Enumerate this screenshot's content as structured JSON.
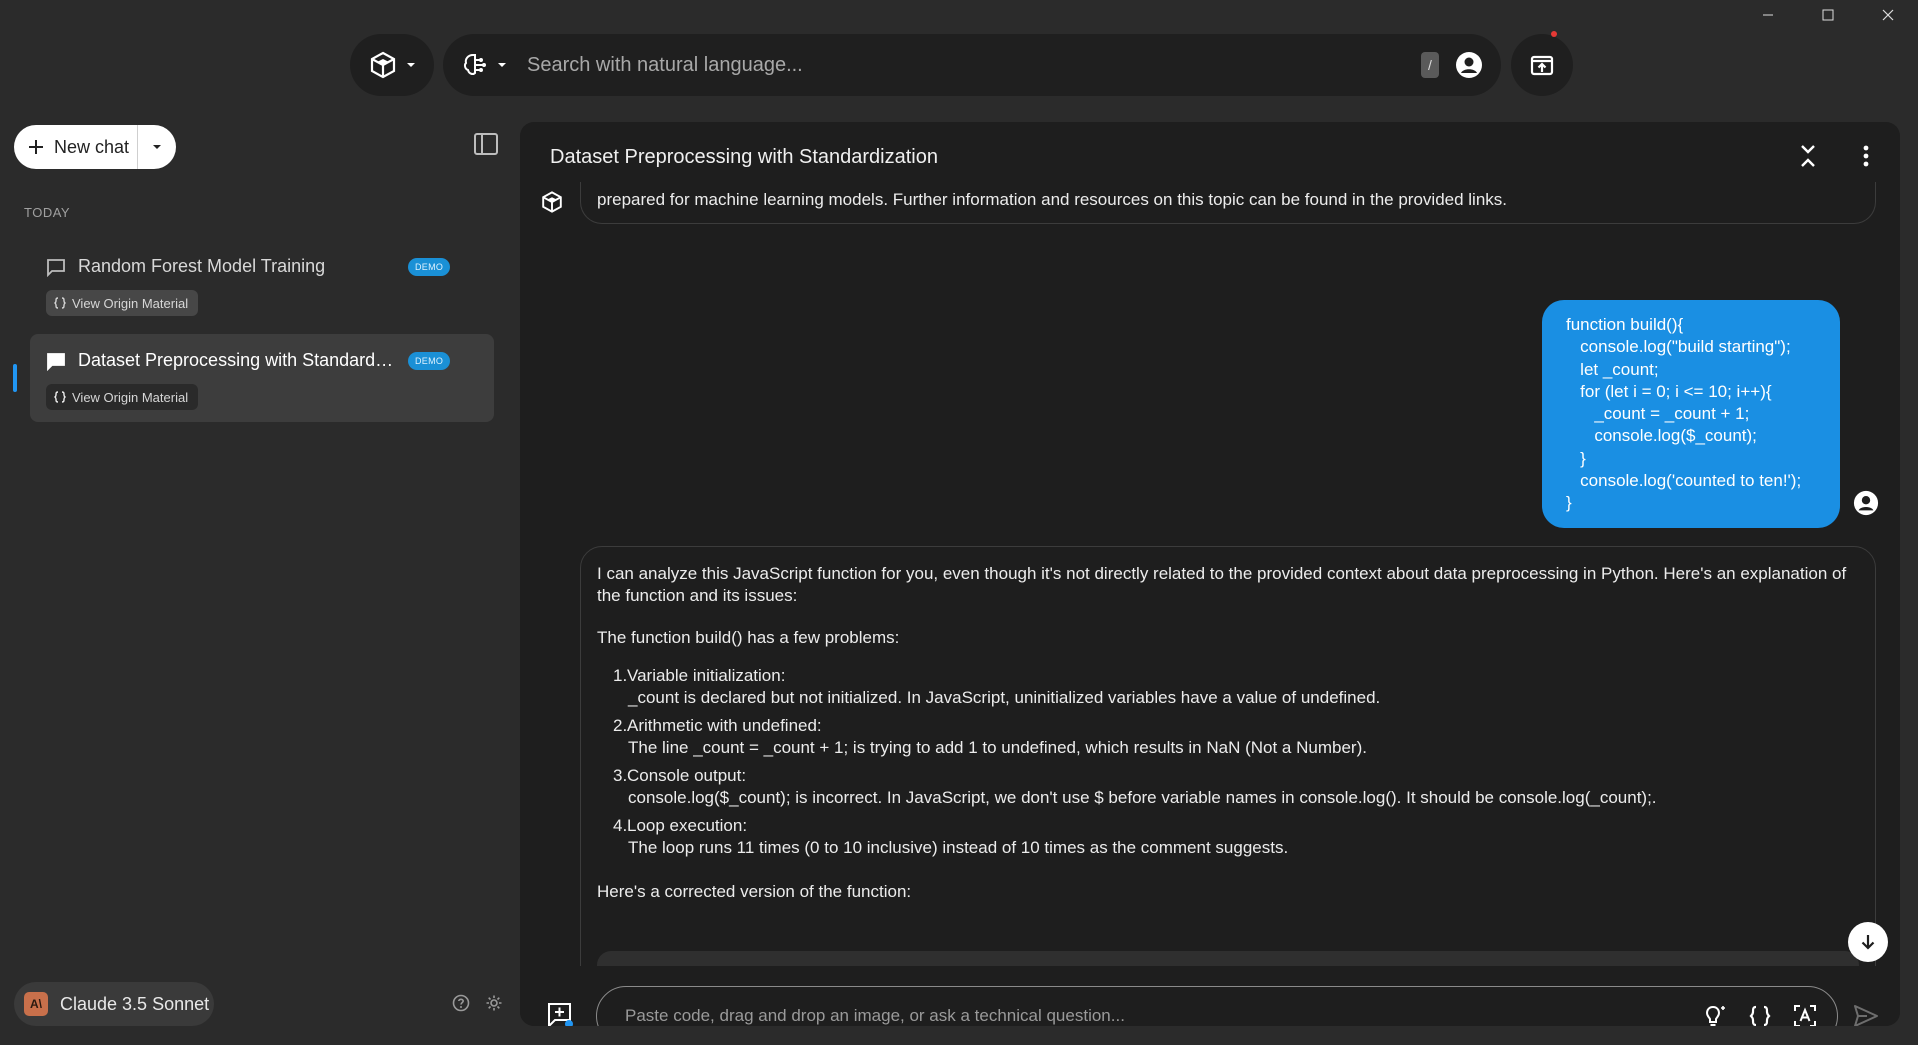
{
  "window": {
    "controls": [
      "minimize",
      "maximize",
      "close"
    ]
  },
  "topbar": {
    "search_placeholder": "Search with natural language...",
    "shortcut_key": "/"
  },
  "sidebar": {
    "new_chat_label": "New chat",
    "section_label": "TODAY",
    "chats": [
      {
        "title": "Random Forest Model Training",
        "badge": "DEMO",
        "origin_label": "View Origin Material",
        "active": false
      },
      {
        "title": "Dataset Preprocessing with Standardization",
        "badge": "DEMO",
        "origin_label": "View Origin Material",
        "active": true
      }
    ],
    "model_name": "Claude 3.5 Sonnet",
    "model_logo_text": "A\\"
  },
  "conversation": {
    "title": "Dataset Preprocessing with Standardization",
    "previous_message_tail": "prepared for machine learning models. Further information and resources on this topic can be found in the provided links.",
    "user_code": "function build(){\n   console.log(\"build starting\");\n   let _count;\n   for (let i = 0; i <= 10; i++){\n      _count = _count + 1;\n      console.log($_count);\n   }\n   console.log('counted to ten!');\n}",
    "assistant": {
      "intro": "I can analyze this JavaScript function for you, even though it's not directly related to the provided context about data preprocessing in Python. Here's an explanation of the function and its issues:",
      "problems_heading": "The function build() has a few problems:",
      "items": [
        {
          "num": "1.",
          "title": "Variable initialization:",
          "desc": "_count is declared but not initialized. In JavaScript, uninitialized variables have a value of undefined."
        },
        {
          "num": "2.",
          "title": "Arithmetic with undefined:",
          "desc": "The line _count = _count + 1; is trying to add 1 to undefined, which results in NaN (Not a Number)."
        },
        {
          "num": "3.",
          "title": "Console output:",
          "desc": "console.log($_count); is incorrect. In JavaScript, we don't use $ before variable names in console.log(). It should be console.log(_count);."
        },
        {
          "num": "4.",
          "title": "Loop execution:",
          "desc": "The loop runs 11 times (0 to 10 inclusive) instead of 10 times as the comment suggests."
        }
      ],
      "outro": "Here's a corrected version of the function:"
    }
  },
  "composer": {
    "placeholder": "Paste code, drag and drop an image, or ask a technical question..."
  },
  "colors": {
    "accent": "#1a8fe3",
    "badge": "#1a90d6",
    "panel": "#1e1e1e",
    "background": "#2b2b2b"
  }
}
